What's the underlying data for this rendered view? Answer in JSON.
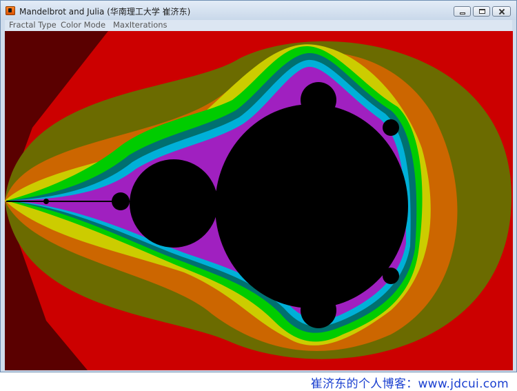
{
  "window": {
    "title": "Mandelbrot and Julia (华南理工大学 崔济东)",
    "icon": "app-icon"
  },
  "menu": {
    "items": [
      {
        "label": "Fractal Type"
      },
      {
        "label": "Color Mode"
      },
      {
        "label": "MaxIterations"
      }
    ]
  },
  "fractal": {
    "colors": {
      "outer": "#cc0000",
      "dark_band": "#5a0000",
      "olive": "#6b6b00",
      "orange": "#cc6600",
      "yellow": "#cccc00",
      "green": "#00cc00",
      "teal": "#007070",
      "cyan": "#00b0d8",
      "blue": "#2a3ad8",
      "purple": "#a020c0",
      "set": "#000000"
    }
  },
  "watermark": {
    "text": "崔济东的个人博客：www.jdcui.com"
  }
}
